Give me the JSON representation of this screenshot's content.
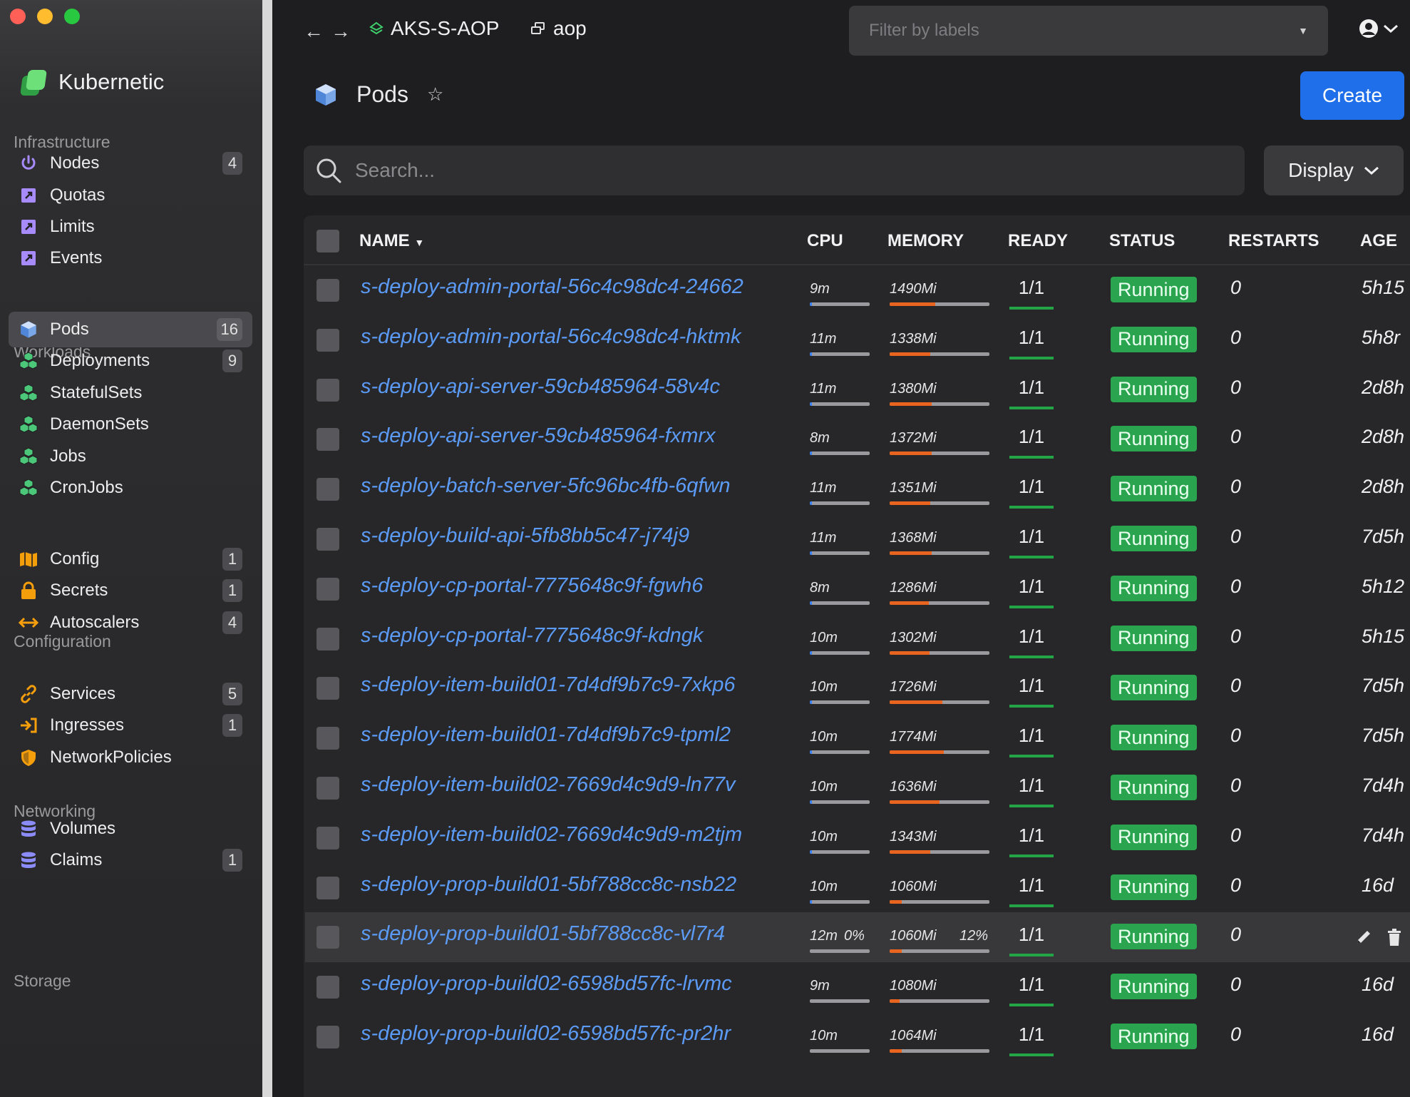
{
  "app": {
    "name": "Kubernetic"
  },
  "sidebar": {
    "sections": [
      {
        "label": "Infrastructure"
      },
      {
        "label": "Workloads"
      },
      {
        "label": "Configuration"
      },
      {
        "label": "Networking"
      },
      {
        "label": "Storage"
      }
    ],
    "items": [
      {
        "label": "Nodes",
        "badge": "4",
        "icon": "power-icon"
      },
      {
        "label": "Quotas",
        "badge": "",
        "icon": "external-box-icon"
      },
      {
        "label": "Limits",
        "badge": "",
        "icon": "external-box-icon"
      },
      {
        "label": "Events",
        "badge": "",
        "icon": "external-box-icon"
      },
      {
        "label": "Pods",
        "badge": "16",
        "icon": "cube-icon"
      },
      {
        "label": "Deployments",
        "badge": "9",
        "icon": "cubes-icon"
      },
      {
        "label": "StatefulSets",
        "badge": "",
        "icon": "cubes-icon"
      },
      {
        "label": "DaemonSets",
        "badge": "",
        "icon": "cubes-icon"
      },
      {
        "label": "Jobs",
        "badge": "",
        "icon": "cubes-icon"
      },
      {
        "label": "CronJobs",
        "badge": "",
        "icon": "cubes-icon"
      },
      {
        "label": "Config",
        "badge": "1",
        "icon": "map-icon"
      },
      {
        "label": "Secrets",
        "badge": "1",
        "icon": "lock-icon"
      },
      {
        "label": "Autoscalers",
        "badge": "4",
        "icon": "arrows-horizontal-icon"
      },
      {
        "label": "Services",
        "badge": "5",
        "icon": "link-icon"
      },
      {
        "label": "Ingresses",
        "badge": "1",
        "icon": "sign-in-icon"
      },
      {
        "label": "NetworkPolicies",
        "badge": "",
        "icon": "shield-icon"
      },
      {
        "label": "Volumes",
        "badge": "",
        "icon": "database-icon"
      },
      {
        "label": "Claims",
        "badge": "1",
        "icon": "database-icon"
      }
    ]
  },
  "topbar": {
    "cluster": "AKS-S-AOP",
    "namespace": "aop",
    "filter_placeholder": "Filter by labels"
  },
  "page": {
    "title": "Pods",
    "create_label": "Create",
    "search_placeholder": "Search...",
    "display_label": "Display"
  },
  "table": {
    "columns": {
      "name": "NAME",
      "cpu": "CPU",
      "memory": "MEMORY",
      "ready": "READY",
      "status": "STATUS",
      "restarts": "RESTARTS",
      "age": "AGE"
    },
    "rows": [
      {
        "name": "s-deploy-admin-portal-56c4c98dc4-24662",
        "cpu": "9m",
        "cpu_pct": "",
        "cpu_fill": 0.03,
        "memory": "1490Mi",
        "mem_pct": "",
        "mem_fill": 0.46,
        "ready": "1/1",
        "status": "Running",
        "restarts": "0",
        "age": "5h15"
      },
      {
        "name": "s-deploy-admin-portal-56c4c98dc4-hktmk",
        "cpu": "11m",
        "cpu_pct": "",
        "cpu_fill": 0.04,
        "memory": "1338Mi",
        "mem_pct": "",
        "mem_fill": 0.41,
        "ready": "1/1",
        "status": "Running",
        "restarts": "0",
        "age": "5h8r"
      },
      {
        "name": "s-deploy-api-server-59cb485964-58v4c",
        "cpu": "11m",
        "cpu_pct": "",
        "cpu_fill": 0.04,
        "memory": "1380Mi",
        "mem_pct": "",
        "mem_fill": 0.42,
        "ready": "1/1",
        "status": "Running",
        "restarts": "0",
        "age": "2d8h"
      },
      {
        "name": "s-deploy-api-server-59cb485964-fxmrx",
        "cpu": "8m",
        "cpu_pct": "",
        "cpu_fill": 0.03,
        "memory": "1372Mi",
        "mem_pct": "",
        "mem_fill": 0.42,
        "ready": "1/1",
        "status": "Running",
        "restarts": "0",
        "age": "2d8h"
      },
      {
        "name": "s-deploy-batch-server-5fc96bc4fb-6qfwn",
        "cpu": "11m",
        "cpu_pct": "",
        "cpu_fill": 0.04,
        "memory": "1351Mi",
        "mem_pct": "",
        "mem_fill": 0.41,
        "ready": "1/1",
        "status": "Running",
        "restarts": "0",
        "age": "2d8h"
      },
      {
        "name": "s-deploy-build-api-5fb8bb5c47-j74j9",
        "cpu": "11m",
        "cpu_pct": "",
        "cpu_fill": 0.04,
        "memory": "1368Mi",
        "mem_pct": "",
        "mem_fill": 0.42,
        "ready": "1/1",
        "status": "Running",
        "restarts": "0",
        "age": "7d5h"
      },
      {
        "name": "s-deploy-cp-portal-7775648c9f-fgwh6",
        "cpu": "8m",
        "cpu_pct": "",
        "cpu_fill": 0.03,
        "memory": "1286Mi",
        "mem_pct": "",
        "mem_fill": 0.39,
        "ready": "1/1",
        "status": "Running",
        "restarts": "0",
        "age": "5h12"
      },
      {
        "name": "s-deploy-cp-portal-7775648c9f-kdngk",
        "cpu": "10m",
        "cpu_pct": "",
        "cpu_fill": 0.03,
        "memory": "1302Mi",
        "mem_pct": "",
        "mem_fill": 0.4,
        "ready": "1/1",
        "status": "Running",
        "restarts": "0",
        "age": "5h15"
      },
      {
        "name": "s-deploy-item-build01-7d4df9b7c9-7xkp6",
        "cpu": "10m",
        "cpu_pct": "",
        "cpu_fill": 0.03,
        "memory": "1726Mi",
        "mem_pct": "",
        "mem_fill": 0.53,
        "ready": "1/1",
        "status": "Running",
        "restarts": "0",
        "age": "7d5h"
      },
      {
        "name": "s-deploy-item-build01-7d4df9b7c9-tpml2",
        "cpu": "10m",
        "cpu_pct": "",
        "cpu_fill": 0.03,
        "memory": "1774Mi",
        "mem_pct": "",
        "mem_fill": 0.54,
        "ready": "1/1",
        "status": "Running",
        "restarts": "0",
        "age": "7d5h"
      },
      {
        "name": "s-deploy-item-build02-7669d4c9d9-ln77v",
        "cpu": "10m",
        "cpu_pct": "",
        "cpu_fill": 0.03,
        "memory": "1636Mi",
        "mem_pct": "",
        "mem_fill": 0.5,
        "ready": "1/1",
        "status": "Running",
        "restarts": "0",
        "age": "7d4h"
      },
      {
        "name": "s-deploy-item-build02-7669d4c9d9-m2tjm",
        "cpu": "10m",
        "cpu_pct": "",
        "cpu_fill": 0.03,
        "memory": "1343Mi",
        "mem_pct": "",
        "mem_fill": 0.41,
        "ready": "1/1",
        "status": "Running",
        "restarts": "0",
        "age": "7d4h"
      },
      {
        "name": "s-deploy-prop-build01-5bf788cc8c-nsb22",
        "cpu": "10m",
        "cpu_pct": "",
        "cpu_fill": 0.03,
        "memory": "1060Mi",
        "mem_pct": "",
        "mem_fill": 0.12,
        "ready": "1/1",
        "status": "Running",
        "restarts": "0",
        "age": "16d"
      },
      {
        "name": "s-deploy-prop-build01-5bf788cc8c-vl7r4",
        "cpu": "12m",
        "cpu_pct": "0%",
        "cpu_fill": 0.0,
        "memory": "1060Mi",
        "mem_pct": "12%",
        "mem_fill": 0.12,
        "ready": "1/1",
        "status": "Running",
        "restarts": "0",
        "age": "",
        "hover": true
      },
      {
        "name": "s-deploy-prop-build02-6598bd57fc-lrvmc",
        "cpu": "9m",
        "cpu_pct": "",
        "cpu_fill": 0.0,
        "memory": "1080Mi",
        "mem_pct": "",
        "mem_fill": 0.1,
        "ready": "1/1",
        "status": "Running",
        "restarts": "0",
        "age": "16d"
      },
      {
        "name": "s-deploy-prop-build02-6598bd57fc-pr2hr",
        "cpu": "10m",
        "cpu_pct": "",
        "cpu_fill": 0.0,
        "memory": "1064Mi",
        "mem_pct": "",
        "mem_fill": 0.12,
        "ready": "1/1",
        "status": "Running",
        "restarts": "0",
        "age": "16d"
      }
    ]
  },
  "colors": {
    "accent": "#1f6feb",
    "link": "#5b9bf5",
    "running": "#2aa44f",
    "cpu_bar": "#3b82f6",
    "mem_bar": "#e8641f"
  }
}
